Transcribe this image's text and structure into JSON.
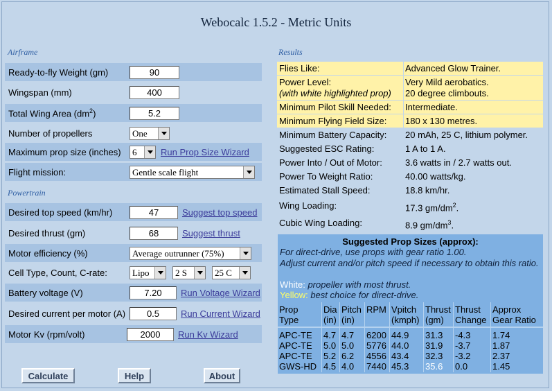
{
  "title": "Webocalc 1.5.2 - Metric Units",
  "airframe": {
    "heading": "Airframe",
    "weight": {
      "label": "Ready-to-fly Weight (gm)",
      "value": "90"
    },
    "wingspan": {
      "label": "Wingspan (mm)",
      "value": "400"
    },
    "wing_area": {
      "label_pre": "Total Wing Area (dm",
      "label_sup": "2",
      "label_post": ")",
      "value": "5.2"
    },
    "propellers": {
      "label": "Number of propellers",
      "value": "One"
    },
    "prop_size": {
      "label": "Maximum prop size (inches)",
      "value": "6",
      "link": "Run Prop Size Wizard"
    },
    "mission": {
      "label": "Flight mission:",
      "value": "Gentle scale flight"
    }
  },
  "powertrain": {
    "heading": "Powertrain",
    "top_speed": {
      "label": "Desired top speed (km/hr)",
      "value": "47",
      "link": "Suggest top speed"
    },
    "thrust": {
      "label": "Desired thrust (gm)",
      "value": "68",
      "link": "Suggest thrust"
    },
    "efficiency": {
      "label": "Motor efficiency (%)",
      "value": "Average outrunner (75%)"
    },
    "cell": {
      "label": "Cell Type, Count, C-rate:",
      "type": "Lipo",
      "count": "2 S",
      "crate": "25 C"
    },
    "voltage": {
      "label": "Battery voltage (V)",
      "value": "7.20",
      "link": "Run Voltage Wizard"
    },
    "current": {
      "label": "Desired current per motor (A)",
      "value": "0.5",
      "link": "Run Current Wizard"
    },
    "kv": {
      "label": "Motor Kv (rpm/volt)",
      "value": "2000",
      "link": "Run Kv Wizard"
    }
  },
  "buttons": {
    "calculate": "Calculate",
    "help": "Help",
    "about": "About"
  },
  "results": {
    "heading": "Results",
    "rows": [
      {
        "key": "Flies Like:",
        "value": "Advanced Glow Trainer."
      },
      {
        "key1": "Power Level:",
        "key2": "(with white highlighted prop)",
        "value1": "Very Mild aerobatics.",
        "value2": "20 degree climbouts."
      },
      {
        "key": "Minimum Pilot Skill Needed:",
        "value": "Intermediate."
      },
      {
        "key": "Minimum Flying Field Size:",
        "value": "180 x 130 metres."
      },
      {
        "key": "Minimum Battery Capacity:",
        "value": "20 mAh, 25 C, lithium polymer."
      },
      {
        "key": "Suggested ESC Rating:",
        "value": "1 A to 1 A."
      },
      {
        "key": "Power Into / Out of Motor:",
        "value": "3.6 watts in / 2.7 watts out."
      },
      {
        "key": "Power To Weight Ratio:",
        "value": "40.00 watts/kg."
      },
      {
        "key": "Estimated Stall Speed:",
        "value": "18.8 km/hr."
      },
      {
        "key": "Wing Loading:",
        "value": "17.3 gm/dm",
        "sup": "2",
        "tail": "."
      },
      {
        "key": "Cubic Wing Loading:",
        "value": "8.9 gm/dm",
        "sup": "3",
        "tail": "."
      }
    ]
  },
  "props": {
    "heading": "Suggested Prop Sizes (approx):",
    "note1": "For direct-drive, use props with gear ratio 1.00.",
    "note2": "Adjust current and/or pitch speed if necessary to obtain this ratio.",
    "white_word": "White:",
    "white_text": " propeller with most thrust.",
    "yellow_word": "Yellow:",
    "yellow_text": " best choice for direct-drive.",
    "highlight_white": "#ffffff",
    "highlight_yellow": "#ffff66",
    "headers": [
      [
        "Prop",
        "Type"
      ],
      [
        "Dia",
        "(in)"
      ],
      [
        "Pitch",
        "(in)"
      ],
      [
        "RPM",
        ""
      ],
      [
        "Vpitch",
        "(kmph)"
      ],
      [
        "Thrust",
        "(gm)"
      ],
      [
        "Thrust",
        "Change"
      ],
      [
        "Approx",
        "Gear Ratio"
      ]
    ],
    "rows": [
      [
        "APC-TE",
        "4.7",
        "4.7",
        "6200",
        "44.9",
        "31.3",
        "-4.3",
        "1.74"
      ],
      [
        "APC-TE",
        "5.0",
        "5.0",
        "5776",
        "44.0",
        "31.9",
        "-3.7",
        "1.87"
      ],
      [
        "APC-TE",
        "5.2",
        "6.2",
        "4556",
        "43.4",
        "32.3",
        "-3.2",
        "2.37"
      ],
      [
        "GWS-HD",
        "4.5",
        "4.0",
        "7440",
        "45.3",
        "35.6",
        "0.0",
        "1.45"
      ]
    ]
  }
}
